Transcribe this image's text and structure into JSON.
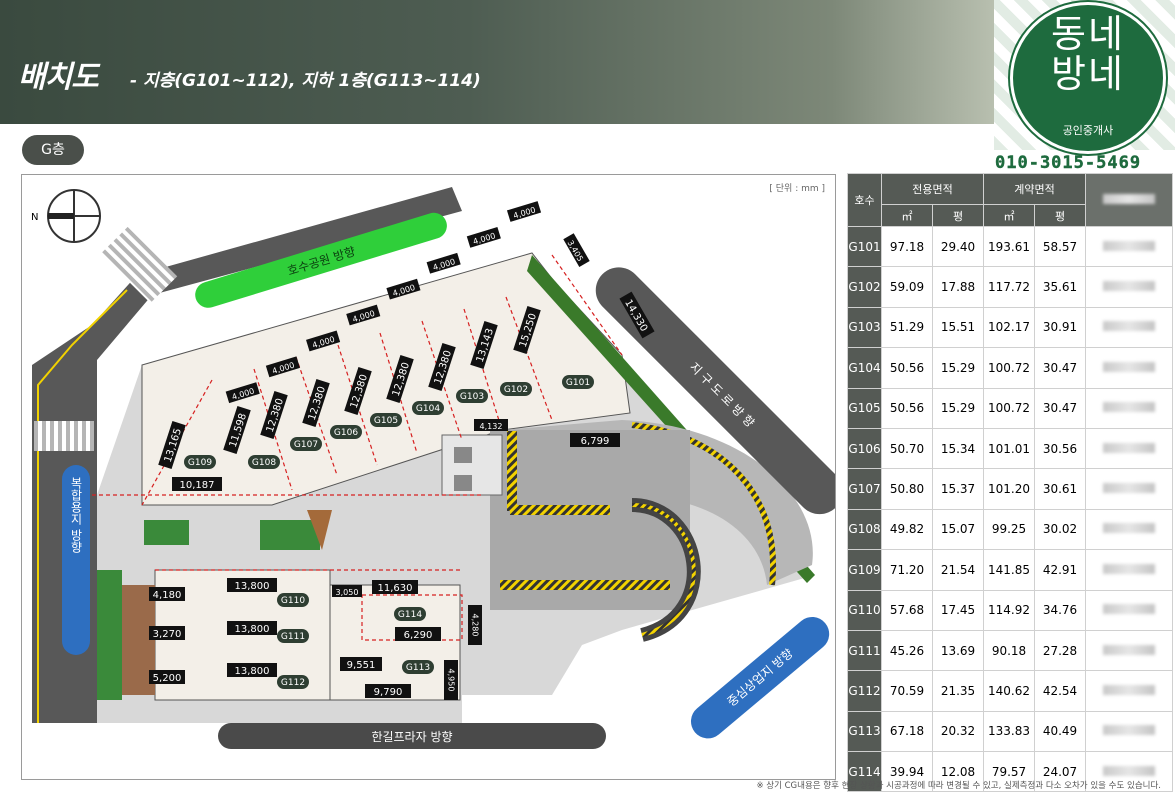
{
  "header": {
    "title": "배치도",
    "subtitle": "- 지층(G101~112), 지하 1층(G113~114)"
  },
  "floor_pill": "G층",
  "plan": {
    "unit_label": "[ 단위 : mm ]",
    "compass_label": "N",
    "direction_labels": {
      "lake_park": "호수공원 방향",
      "complex_land": "복합용지 방향",
      "top_right": "지 구 도 로 방 향",
      "central_commercial": "중심상업지 방향",
      "hangil_plaza": "한길프라자 방향"
    },
    "units": [
      "G101",
      "G102",
      "G103",
      "G104",
      "G105",
      "G106",
      "G107",
      "G108",
      "G109",
      "G110",
      "G111",
      "G112",
      "G113",
      "G114"
    ],
    "dimensions": {
      "widths_top": [
        "4,000",
        "4,000",
        "4,000",
        "4,000",
        "4,000",
        "4,000",
        "4,000",
        "4,000",
        "3,405"
      ],
      "depths": [
        "13,165",
        "11,598",
        "12,380",
        "12,380",
        "12,380",
        "12,380",
        "12,380",
        "13,143",
        "15,250",
        "14,330"
      ],
      "d_10187": "10,187",
      "d_6799": "6,799",
      "d_4132": "4,132",
      "d_13800a": "13,800",
      "d_13800b": "13,800",
      "d_13800c": "13,800",
      "d_4180": "4,180",
      "d_3270": "3,270",
      "d_5200": "5,200",
      "d_11630": "11,630",
      "d_3050": "3,050",
      "d_6290": "6,290",
      "d_4280": "4,280",
      "d_9551": "9,551",
      "d_4950": "4,950",
      "d_9790": "9,790"
    }
  },
  "logo": {
    "line1": "동네",
    "line2": "방네",
    "line3": "공인중개사",
    "phone": "010-3015-5469"
  },
  "table": {
    "h_unit": "호수",
    "h_exclusive": "전용면적",
    "h_contract": "계약면적",
    "h_m2": "㎡",
    "h_py": "평",
    "rows": [
      {
        "unit": "G101",
        "ex_m2": "97.18",
        "ex_py": "29.40",
        "ct_m2": "193.61",
        "ct_py": "58.57"
      },
      {
        "unit": "G102",
        "ex_m2": "59.09",
        "ex_py": "17.88",
        "ct_m2": "117.72",
        "ct_py": "35.61"
      },
      {
        "unit": "G103",
        "ex_m2": "51.29",
        "ex_py": "15.51",
        "ct_m2": "102.17",
        "ct_py": "30.91"
      },
      {
        "unit": "G104",
        "ex_m2": "50.56",
        "ex_py": "15.29",
        "ct_m2": "100.72",
        "ct_py": "30.47"
      },
      {
        "unit": "G105",
        "ex_m2": "50.56",
        "ex_py": "15.29",
        "ct_m2": "100.72",
        "ct_py": "30.47"
      },
      {
        "unit": "G106",
        "ex_m2": "50.70",
        "ex_py": "15.34",
        "ct_m2": "101.01",
        "ct_py": "30.56"
      },
      {
        "unit": "G107",
        "ex_m2": "50.80",
        "ex_py": "15.37",
        "ct_m2": "101.20",
        "ct_py": "30.61"
      },
      {
        "unit": "G108",
        "ex_m2": "49.82",
        "ex_py": "15.07",
        "ct_m2": "99.25",
        "ct_py": "30.02"
      },
      {
        "unit": "G109",
        "ex_m2": "71.20",
        "ex_py": "21.54",
        "ct_m2": "141.85",
        "ct_py": "42.91"
      },
      {
        "unit": "G110",
        "ex_m2": "57.68",
        "ex_py": "17.45",
        "ct_m2": "114.92",
        "ct_py": "34.76"
      },
      {
        "unit": "G111",
        "ex_m2": "45.26",
        "ex_py": "13.69",
        "ct_m2": "90.18",
        "ct_py": "27.28"
      },
      {
        "unit": "G112",
        "ex_m2": "70.59",
        "ex_py": "21.35",
        "ct_m2": "140.62",
        "ct_py": "42.54"
      },
      {
        "unit": "G113",
        "ex_m2": "67.18",
        "ex_py": "20.32",
        "ct_m2": "133.83",
        "ct_py": "40.49"
      },
      {
        "unit": "G114",
        "ex_m2": "39.94",
        "ex_py": "12.08",
        "ct_m2": "79.57",
        "ct_py": "24.07"
      }
    ]
  },
  "footnote": "※ 상기 CG내용은 향후 현장 상황과 시공과정에 따라 변경될 수 있고, 실제측정과 다소 오차가 있을 수도 있습니다.",
  "colors": {
    "accent_green": "#1e6b3e",
    "road": "#555555",
    "lawn": "#2fcf3a",
    "blue_sign": "#2e6fc0",
    "dim_red": "#d62020"
  }
}
